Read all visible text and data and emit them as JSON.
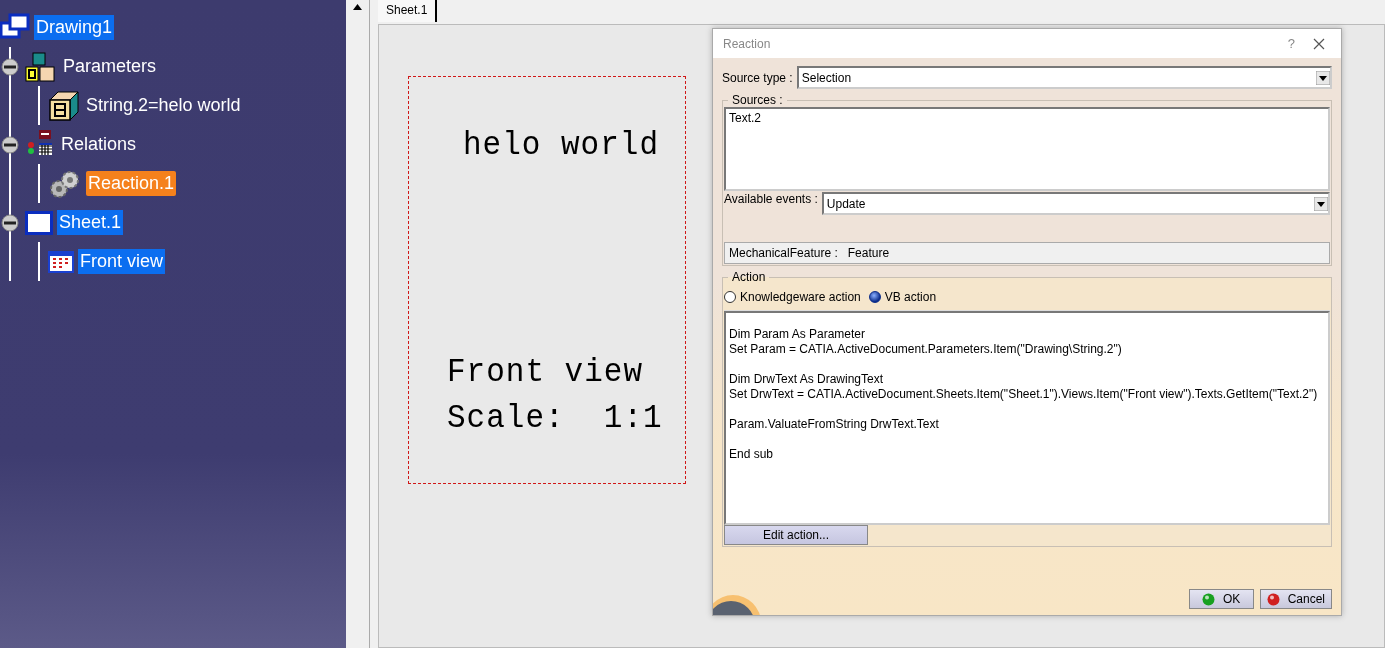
{
  "tree": {
    "label": "Drawing1",
    "kind": "drawing",
    "selected": true,
    "active": false,
    "children": [
      {
        "label": "Parameters",
        "kind": "parameters",
        "selected": false,
        "active": false,
        "expanded": true,
        "children": [
          {
            "label": "String.2=helo world",
            "kind": "string-param",
            "selected": false,
            "active": false
          }
        ]
      },
      {
        "label": "Relations",
        "kind": "relations",
        "selected": false,
        "active": false,
        "expanded": true,
        "children": [
          {
            "label": "Reaction.1",
            "kind": "reaction",
            "selected": false,
            "active": true
          }
        ]
      },
      {
        "label": "Sheet.1",
        "kind": "sheet",
        "selected": true,
        "active": false,
        "expanded": true,
        "children": [
          {
            "label": "Front view",
            "kind": "view",
            "selected": true,
            "active": false
          }
        ]
      }
    ]
  },
  "sheet_tabs": [
    {
      "label": "Sheet.1",
      "selected": true
    }
  ],
  "drawing": {
    "texts": [
      "helo world",
      "Front view",
      "Scale:  1:1"
    ]
  },
  "dialog": {
    "title": "Reaction",
    "help": "?",
    "source_type": {
      "label": "Source type :",
      "value": "Selection"
    },
    "sources": {
      "label": "Sources :",
      "items": [
        "Text.2"
      ]
    },
    "events": {
      "label": "Available events :",
      "value": "Update"
    },
    "feature": {
      "label": "MechanicalFeature :",
      "value": "Feature"
    },
    "action": {
      "label": "Action",
      "options": [
        {
          "label": "Knowledgeware action",
          "selected": false
        },
        {
          "label": "VB action",
          "selected": true
        }
      ],
      "code": [
        [
          "Dim Param As Parameter",
          "Set Param = CATIA.ActiveDocument.Parameters.Item(\"Drawing\\String.2\")"
        ],
        [
          "Dim DrwText As DrawingText",
          "Set DrwText = CATIA.ActiveDocument.Sheets.Item(\"Sheet.1\").Views.Item(\"Front view\").Texts.GetItem(\"Text.2\")"
        ],
        [
          "Param.ValuateFromString DrwText.Text"
        ],
        [
          "End sub"
        ]
      ],
      "edit_button": "Edit action..."
    },
    "buttons": [
      {
        "label": "OK",
        "kind": "ok"
      },
      {
        "label": "Cancel",
        "kind": "cancel"
      }
    ]
  }
}
